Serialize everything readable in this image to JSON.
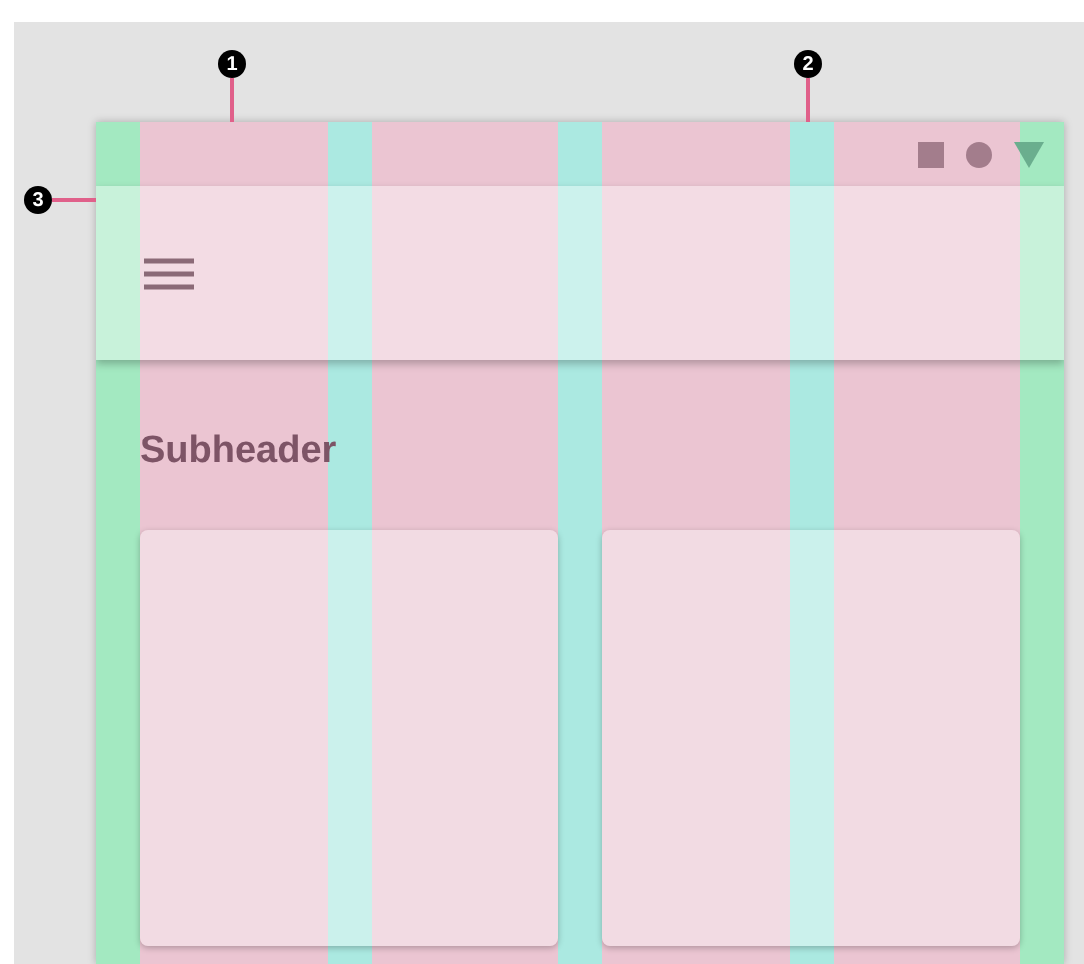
{
  "callouts": [
    {
      "label": "1"
    },
    {
      "label": "2"
    },
    {
      "label": "3"
    }
  ],
  "subheader": "Subheader"
}
